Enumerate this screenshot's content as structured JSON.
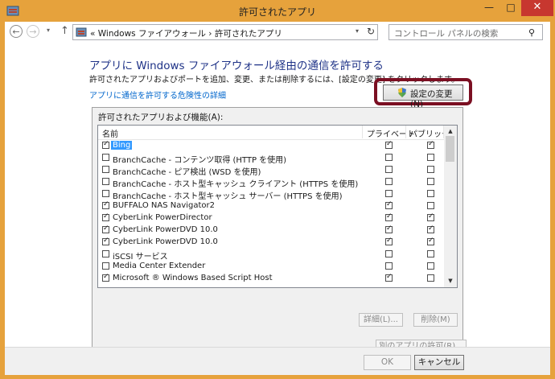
{
  "window": {
    "title": "許可されたアプリ",
    "minimize_glyph": "—",
    "maximize_glyph": "□",
    "close_glyph": "✕"
  },
  "nav": {
    "back_glyph": "←",
    "forward_glyph": "→",
    "dropdown_glyph": "▾",
    "up_glyph": "↑",
    "breadcrumb": "« Windows ファイアウォール › 許可されたアプリ",
    "address_dropdown_glyph": "▾",
    "refresh_glyph": "↻",
    "search_placeholder": "コントロール パネルの検索",
    "search_glyph": "⚲"
  },
  "main": {
    "heading": "アプリに Windows ファイアウォール経由の通信を許可する",
    "description": "許可されたアプリおよびポートを追加、変更、または削除するには、[設定の変更] をクリックします。",
    "risk_link": "アプリに通信を許可する危険性の詳細",
    "change_settings_label": "設定の変更(N)"
  },
  "list": {
    "label": "許可されたアプリおよび機能(A):",
    "columns": {
      "name": "名前",
      "private": "プライベート",
      "public": "パブリック"
    },
    "rows": [
      {
        "name": "Bing",
        "enabled": true,
        "private": true,
        "public": true,
        "selected": true
      },
      {
        "name": "BranchCache - コンテンツ取得 (HTTP を使用)",
        "enabled": false,
        "private": false,
        "public": false,
        "selected": false
      },
      {
        "name": "BranchCache - ピア検出 (WSD を使用)",
        "enabled": false,
        "private": false,
        "public": false,
        "selected": false
      },
      {
        "name": "BranchCache - ホスト型キャッシュ クライアント (HTTPS を使用)",
        "enabled": false,
        "private": false,
        "public": false,
        "selected": false
      },
      {
        "name": "BranchCache - ホスト型キャッシュ サーバー (HTTPS を使用)",
        "enabled": false,
        "private": false,
        "public": false,
        "selected": false
      },
      {
        "name": "BUFFALO NAS Navigator2",
        "enabled": true,
        "private": true,
        "public": false,
        "selected": false
      },
      {
        "name": "CyberLink PowerDirector",
        "enabled": true,
        "private": true,
        "public": true,
        "selected": false
      },
      {
        "name": "CyberLink PowerDVD 10.0",
        "enabled": true,
        "private": true,
        "public": true,
        "selected": false
      },
      {
        "name": "CyberLink PowerDVD 10.0",
        "enabled": true,
        "private": true,
        "public": true,
        "selected": false
      },
      {
        "name": "iSCSI サービス",
        "enabled": false,
        "private": false,
        "public": false,
        "selected": false
      },
      {
        "name": "Media Center Extender",
        "enabled": false,
        "private": false,
        "public": false,
        "selected": false
      },
      {
        "name": "Microsoft ® Windows Based Script Host",
        "enabled": true,
        "private": true,
        "public": false,
        "selected": false
      }
    ],
    "scroll_up_glyph": "▲",
    "scroll_down_glyph": "▼",
    "details_label": "詳細(L)...",
    "remove_label": "削除(M)"
  },
  "allow_other_label": "別のアプリの許可(R)...",
  "footer": {
    "ok_label": "OK",
    "cancel_label": "キャンセル"
  },
  "colors": {
    "titlebar": "#e6a23c",
    "selection": "#3399ff",
    "link": "#0066cc",
    "heading": "#1e3287",
    "highlight_ring": "#7b0f22"
  }
}
